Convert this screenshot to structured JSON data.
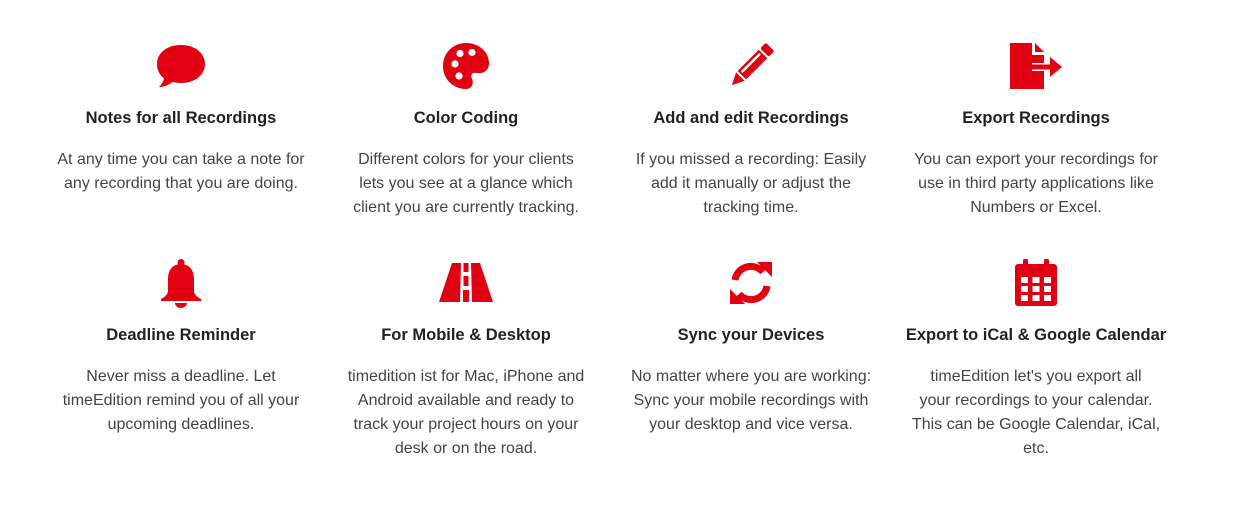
{
  "colors": {
    "accent": "#e00012"
  },
  "features": [
    {
      "icon": "speech-bubble-icon",
      "title": "Notes for all Recordings",
      "lines": [
        "At any time you can take a note for",
        "any recording that you are doing."
      ]
    },
    {
      "icon": "palette-icon",
      "title": "Color Coding",
      "lines": [
        "Different colors for your clients",
        "lets you see at a glance which",
        "client you are currently tracking."
      ]
    },
    {
      "icon": "pencil-icon",
      "title": "Add and edit Recordings",
      "lines": [
        "If you missed a recording: Easily",
        "add it manually or adjust the",
        "tracking time."
      ]
    },
    {
      "icon": "file-export-icon",
      "title": "Export Recordings",
      "lines": [
        "You can export your recordings for",
        "use in third party applications like",
        "Numbers or Excel."
      ]
    },
    {
      "icon": "bell-icon",
      "title": "Deadline Reminder",
      "lines": [
        "Never miss a deadline. Let",
        "timeEdition remind you of all your",
        "upcoming deadlines."
      ]
    },
    {
      "icon": "road-icon",
      "title": "For Mobile & Desktop",
      "lines": [
        "timedition ist for Mac, iPhone and",
        "Android available and ready to",
        "track your project hours on your",
        "desk or on the road."
      ]
    },
    {
      "icon": "sync-icon",
      "title": "Sync your Devices",
      "lines": [
        "No matter where you are working:",
        "Sync your mobile recordings with",
        "your desktop and vice versa."
      ]
    },
    {
      "icon": "calendar-icon",
      "title": "Export to iCal & Google Calendar",
      "lines": [
        "timeEdition let's you export all",
        "your recordings to your calendar.",
        "This can be Google Calendar, iCal,",
        "etc."
      ]
    }
  ]
}
